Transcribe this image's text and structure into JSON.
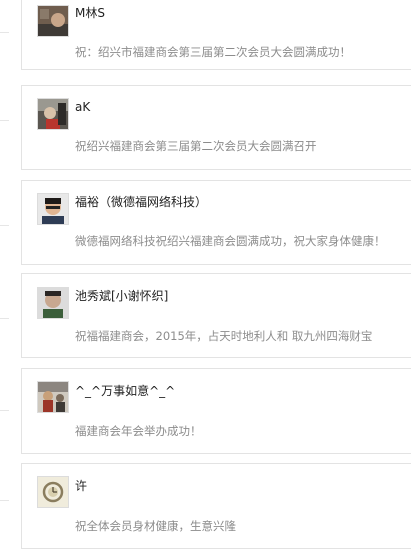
{
  "comments": [
    {
      "name": "M林S",
      "message": "祝：绍兴市福建商会第三届第二次会员大会圆满成功！",
      "avatar_icon": "user-photo-icon"
    },
    {
      "name": "aK",
      "message": "祝绍兴福建商会第三届第二次会员大会圆满召开",
      "avatar_icon": "user-photo-icon"
    },
    {
      "name": "福裕（微德福网络科技）",
      "message": "微德福网络科技祝绍兴福建商会圆满成功，祝大家身体健康！",
      "avatar_icon": "user-photo-icon"
    },
    {
      "name": "池秀斌[小谢怀织]",
      "message": "祝福福建商会，2015年，占天时地利人和 取九州四海财宝",
      "avatar_icon": "user-photo-icon"
    },
    {
      "name": "^_^万事如意^_^",
      "message": "福建商会年会举办成功！",
      "avatar_icon": "user-photo-icon"
    },
    {
      "name": "许",
      "message": "祝全体会员身材健康，生意兴隆",
      "avatar_icon": "user-photo-icon"
    }
  ]
}
